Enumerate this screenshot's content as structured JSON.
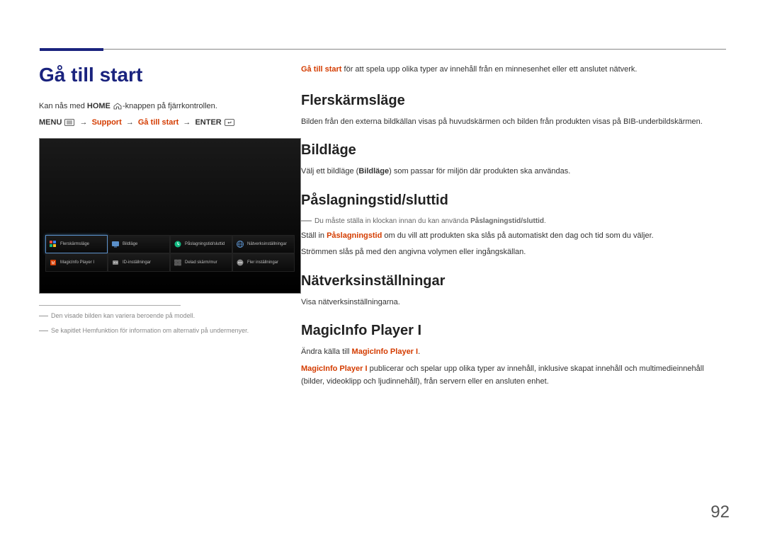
{
  "page_number": "92",
  "left": {
    "main_title": "Gå till start",
    "remote_text_1": "Kan nås med ",
    "remote_bold": "HOME",
    "remote_text_2": "-knappen på fjärrkontrollen.",
    "menu_path": {
      "menu": "MENU",
      "arrow": "→",
      "support": "Support",
      "go_to_start": "Gå till start",
      "enter": "ENTER"
    },
    "screenshot_menu": {
      "row1": [
        {
          "label": "Flerskärmsläge",
          "selected": true,
          "icon": "multi-screen"
        },
        {
          "label": "Bildläge",
          "selected": false,
          "icon": "screen"
        },
        {
          "label": "Påslagningstid/sluttid",
          "selected": false,
          "icon": "clock"
        },
        {
          "label": "Nätverksinställningar",
          "selected": false,
          "icon": "network"
        }
      ],
      "row2": [
        {
          "label": "MagicInfo Player I",
          "selected": false,
          "icon": "magicinfo"
        },
        {
          "label": "ID-inställningar",
          "selected": false,
          "icon": "id"
        },
        {
          "label": "Delad skärm/mur",
          "selected": false,
          "icon": "wall"
        },
        {
          "label": "Fler inställningar",
          "selected": false,
          "icon": "more"
        }
      ]
    },
    "footnote1": "Den visade bilden kan variera beroende på modell.",
    "footnote2": "Se kapitlet Hemfunktion för information om alternativ på undermenyer."
  },
  "right": {
    "intro_orange": "Gå till start",
    "intro_rest": " för att spela upp olika typer av innehåll från en minnesenhet eller ett anslutet nätverk.",
    "sections": [
      {
        "heading": "Flerskärmsläge",
        "body": "Bilden från den externa bildkällan visas på huvudskärmen och bilden från produkten visas på BIB-underbildskärmen."
      },
      {
        "heading": "Bildläge",
        "body_pre": "Välj ett bildläge (",
        "body_bold": "Bildläge",
        "body_post": ") som passar för miljön där produkten ska användas."
      },
      {
        "heading": "Påslagningstid/sluttid",
        "note_pre": "Du måste ställa in klockan innan du kan använda ",
        "note_bold": "Påslagningstid/sluttid",
        "note_post": ".",
        "body2_pre": "Ställ in ",
        "body2_orange": "Påslagningstid",
        "body2_post": " om du vill att produkten ska slås på automatiskt den dag och tid som du väljer.",
        "body3": "Strömmen slås på med den angivna volymen eller ingångskällan."
      },
      {
        "heading": "Nätverksinställningar",
        "body": "Visa nätverksinställningarna."
      },
      {
        "heading": "MagicInfo Player I",
        "body1_pre": "Ändra källa till ",
        "body1_orange": "MagicInfo Player I",
        "body1_post": ".",
        "body2_orange": "MagicInfo Player I",
        "body2_post": " publicerar och spelar upp olika typer av innehåll, inklusive skapat innehåll och multimedieinnehåll (bilder, videoklipp och ljudinnehåll), från servern eller en ansluten enhet."
      }
    ]
  }
}
